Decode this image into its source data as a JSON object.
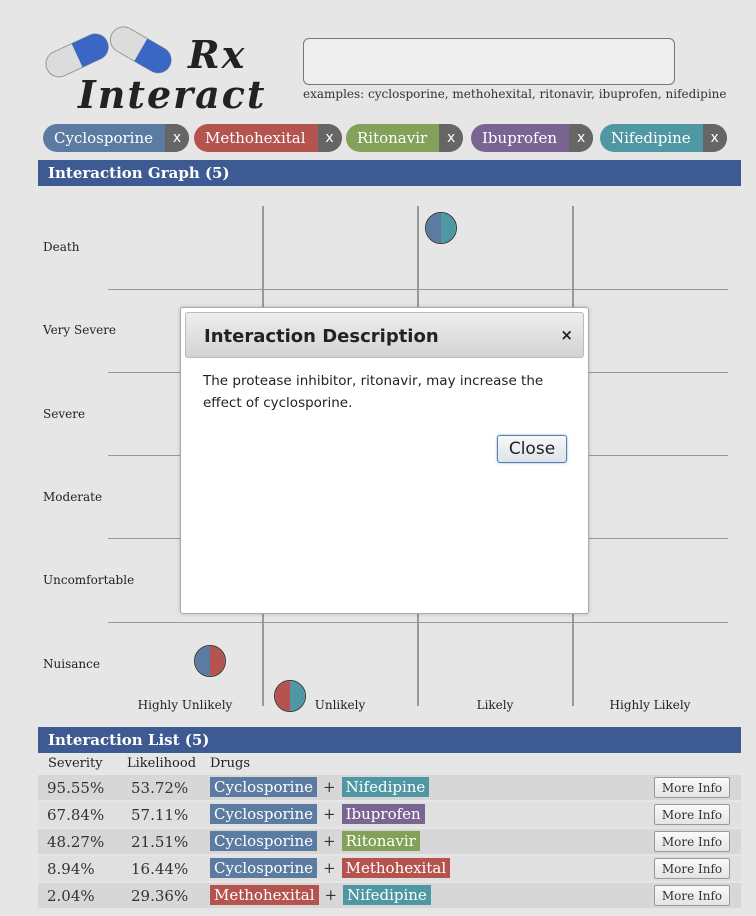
{
  "app": {
    "logo_rx": "Rx",
    "logo_interact": "Interact"
  },
  "search": {
    "value": "",
    "examples": "examples: cyclosporine, methohexital, ritonavir, ibuprofen, nifedipine"
  },
  "drugs": [
    {
      "name": "Cyclosporine",
      "remove": "x",
      "color": "#5b7ba0"
    },
    {
      "name": "Methohexital",
      "remove": "x",
      "color": "#b5534f"
    },
    {
      "name": "Ritonavir",
      "remove": "x",
      "color": "#84a15a"
    },
    {
      "name": "Ibuprofen",
      "remove": "x",
      "color": "#7a6592"
    },
    {
      "name": "Nifedipine",
      "remove": "x",
      "color": "#4f98a3"
    }
  ],
  "graph": {
    "header": "Interaction Graph (5)",
    "severity_levels": [
      "Death",
      "Very Severe",
      "Severe",
      "Moderate",
      "Uncomfortable",
      "Nuisance"
    ],
    "likelihood_levels": [
      "Highly Unlikely",
      "Unlikely",
      "Likely",
      "Highly Likely"
    ]
  },
  "modal": {
    "title": "Interaction Description",
    "close_x": "×",
    "text": "The protease inhibitor, ritonavir, may increase the effect of cyclosporine.",
    "close_button": "Close"
  },
  "list": {
    "header": "Interaction List (5)",
    "columns": {
      "severity": "Severity",
      "likelihood": "Likelihood",
      "drugs": "Drugs"
    },
    "plus": "+",
    "more_info": "More Info",
    "rows": [
      {
        "severity": "95.55%",
        "likelihood": "53.72%",
        "drug_a": "Cyclosporine",
        "drug_b": "Nifedipine"
      },
      {
        "severity": "67.84%",
        "likelihood": "57.11%",
        "drug_a": "Cyclosporine",
        "drug_b": "Ibuprofen"
      },
      {
        "severity": "48.27%",
        "likelihood": "21.51%",
        "drug_a": "Cyclosporine",
        "drug_b": "Ritonavir"
      },
      {
        "severity": "8.94%",
        "likelihood": "16.44%",
        "drug_a": "Cyclosporine",
        "drug_b": "Methohexital"
      },
      {
        "severity": "2.04%",
        "likelihood": "29.36%",
        "drug_a": "Methohexital",
        "drug_b": "Nifedipine"
      }
    ]
  }
}
